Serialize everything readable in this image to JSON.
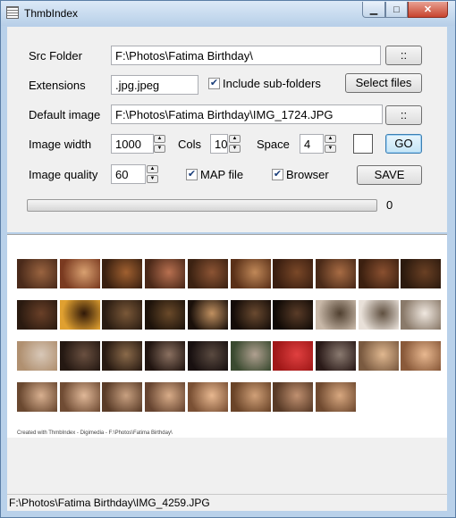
{
  "window": {
    "title": "ThmbIndex",
    "min_icon": "minimize-icon",
    "max_icon": "maximize-icon",
    "close_icon": "close-icon"
  },
  "form": {
    "src_folder": {
      "label": "Src Folder",
      "value": "F:\\Photos\\Fatima Birthday\\",
      "browse_label": "::"
    },
    "extensions": {
      "label": "Extensions",
      "value": ".jpg.jpeg",
      "include_subfolders_label": "Include sub-folders",
      "include_subfolders_checked": true,
      "select_files_label": "Select files"
    },
    "default_image": {
      "label": "Default image",
      "value": "F:\\Photos\\Fatima Birthday\\IMG_1724.JPG",
      "browse_label": "::"
    },
    "image_width": {
      "label": "Image width",
      "value": "1000"
    },
    "cols": {
      "label": "Cols",
      "value": "10"
    },
    "space": {
      "label": "Space",
      "value": "4"
    },
    "background_color": "#ffffff",
    "go_label": "GO",
    "image_quality": {
      "label": "Image quality",
      "value": "60"
    },
    "map_file": {
      "label": "MAP file",
      "checked": true
    },
    "browser": {
      "label": "Browser",
      "checked": true
    },
    "save_label": "SAVE",
    "progress": {
      "value": 0,
      "text": "0"
    }
  },
  "preview": {
    "credit": "Created with ThmbIndex - Digimedia - F:\\Photos\\Fatima Birthday\\",
    "thumbnails": [
      [
        "#4a2a1a",
        "#9a6440"
      ],
      [
        "#7a3a20",
        "#d8a070"
      ],
      [
        "#3a2010",
        "#a06030"
      ],
      [
        "#4a2818",
        "#b87050"
      ],
      [
        "#3c2212",
        "#8c5434"
      ],
      [
        "#5a3018",
        "#c08858"
      ],
      [
        "#3a1e10",
        "#7a4828"
      ],
      [
        "#4a2a18",
        "#a86c44"
      ],
      [
        "#3c2010",
        "#8a5030"
      ],
      [
        "#2c1a0e",
        "#6a4024"
      ],
      [
        "#2a1a10",
        "#6a4028"
      ],
      [
        "#e0a030",
        "#301808"
      ],
      [
        "#2a1c12",
        "#7a5838"
      ],
      [
        "#1c120a",
        "#6a4a2a"
      ],
      [
        "#1a100a",
        "#c09060"
      ],
      [
        "#140c08",
        "#6a4a30"
      ],
      [
        "#100a06",
        "#5a3c28"
      ],
      [
        "#c8b8a8",
        "#504030"
      ],
      [
        "#e8e0d8",
        "#605040"
      ],
      [
        "#8a7a6a",
        "#f0e8e0"
      ],
      [
        "#b09070",
        "#d8c8b8"
      ],
      [
        "#241812",
        "#6a5040"
      ],
      [
        "#281a12",
        "#8a6a4a"
      ],
      [
        "#201410",
        "#8a7060"
      ],
      [
        "#181010",
        "#5a4a40"
      ],
      [
        "#3a4a30",
        "#b0a090"
      ],
      [
        "#a01818",
        "#e04040"
      ],
      [
        "#2a1a18",
        "#8a7a70"
      ],
      [
        "#7a5a40",
        "#e0b890"
      ],
      [
        "#8a5a3a",
        "#e8b890"
      ],
      [
        "#6a4830",
        "#d8b090"
      ],
      [
        "#704c34",
        "#e0b898"
      ],
      [
        "#5a3c28",
        "#c8a080"
      ],
      [
        "#664430",
        "#d8ac88"
      ],
      [
        "#7a5034",
        "#e8b890"
      ],
      [
        "#6a4428",
        "#d0a078"
      ],
      [
        "#583a26",
        "#c09070"
      ],
      [
        "#704a30",
        "#d8a880"
      ]
    ]
  },
  "status": {
    "path": "F:\\Photos\\Fatima Birthday\\IMG_4259.JPG"
  }
}
